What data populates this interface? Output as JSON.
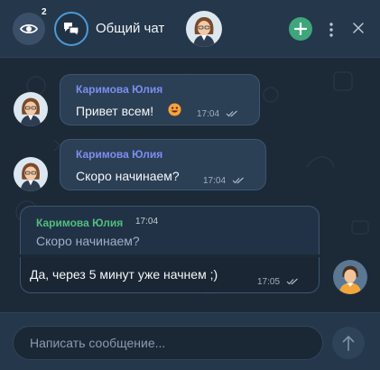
{
  "header": {
    "viewers_count": "2",
    "chat_title": "Общий чат",
    "accent_color": "#4d9ad6",
    "add_color": "#3ea67a"
  },
  "messages": [
    {
      "sender": "Каримова Юлия",
      "text": "Привет всем!",
      "emoji": "smile-emoji",
      "time": "17:04"
    },
    {
      "sender": "Каримова Юлия",
      "text": "Скоро начинаем?",
      "time": "17:04"
    }
  ],
  "reply": {
    "quoted_sender": "Каримова Юлия",
    "quoted_time": "17:04",
    "quoted_text": "Скоро начинаем?",
    "text": "Да, через 5 минут уже начнем ;)",
    "time": "17:05"
  },
  "composer": {
    "placeholder": "Написать сообщение..."
  }
}
